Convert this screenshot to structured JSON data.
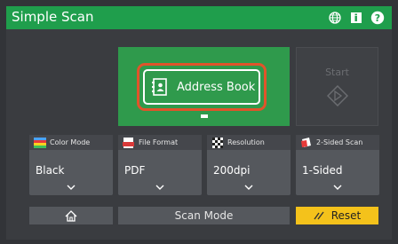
{
  "app": {
    "title": "Simple Scan"
  },
  "header_icons": [
    "globe-icon",
    "info-icon",
    "help-icon"
  ],
  "main": {
    "address_book_label": "Address Book",
    "start_label": "Start"
  },
  "settings": [
    {
      "id": "color-mode",
      "label": "Color Mode",
      "value": "Black",
      "icon": "color-mode-icon"
    },
    {
      "id": "file-format",
      "label": "File Format",
      "value": "PDF",
      "icon": "pdf-file-icon"
    },
    {
      "id": "resolution",
      "label": "Resolution",
      "value": "200dpi",
      "icon": "resolution-icon"
    },
    {
      "id": "two-sided",
      "label": "2-Sided Scan",
      "value": "1-Sided",
      "icon": "two-sided-icon"
    }
  ],
  "bottom": {
    "scan_mode_label": "Scan Mode",
    "reset_label": "Reset"
  },
  "colors": {
    "titlebar": "#1f9e4c",
    "address_tile": "#2f9a4c",
    "highlight_outline": "#e0542a",
    "reset": "#f4c21b",
    "tile": "#55585d"
  }
}
